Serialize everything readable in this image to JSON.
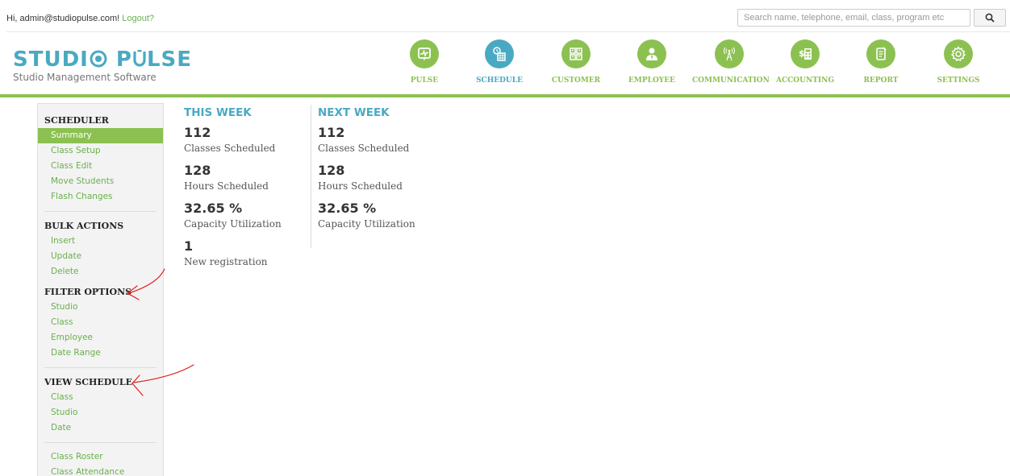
{
  "topbar": {
    "greeting": "Hi, admin@studiopulse.com!",
    "logout": "Logout?",
    "search_placeholder": "Search name, telephone, email, class, program etc"
  },
  "logo": {
    "title": "STUDIO PULSE",
    "title_part1": "STUDI",
    "title_part2": "P",
    "title_part3": "LSE",
    "subtitle": "Studio Management Software"
  },
  "nav": [
    {
      "label": "PULSE",
      "icon": "pulse-monitor-icon",
      "active": false
    },
    {
      "label": "SCHEDULE",
      "icon": "calendar-clock-icon",
      "active": true
    },
    {
      "label": "CUSTOMER",
      "icon": "customer-grid-icon",
      "active": false
    },
    {
      "label": "EMPLOYEE",
      "icon": "employee-icon",
      "active": false
    },
    {
      "label": "COMMUNICATION",
      "icon": "antenna-icon",
      "active": false
    },
    {
      "label": "ACCOUNTING",
      "icon": "calculator-icon",
      "active": false
    },
    {
      "label": "REPORT",
      "icon": "report-icon",
      "active": false
    },
    {
      "label": "SETTINGS",
      "icon": "gear-icon",
      "active": false
    }
  ],
  "sidebar": {
    "sections": [
      {
        "title": "SCHEDULER",
        "items": [
          "Summary",
          "Class Setup",
          "Class Edit",
          "Move Students",
          "Flash Changes"
        ],
        "active_index": 0
      },
      {
        "title": "BULK ACTIONS",
        "items": [
          "Insert",
          "Update",
          "Delete"
        ]
      },
      {
        "title": "FILTER OPTIONS",
        "items": [
          "Studio",
          "Class",
          "Employee",
          "Date Range"
        ]
      },
      {
        "title": "VIEW SCHEDULE",
        "items": [
          "Class",
          "Studio",
          "Date"
        ]
      },
      {
        "title": "",
        "items": [
          "Class Roster",
          "Class Attendance"
        ]
      }
    ]
  },
  "this_week": {
    "title": "THIS WEEK",
    "stats": [
      {
        "value": "112",
        "label": "Classes Scheduled"
      },
      {
        "value": "128",
        "label": "Hours Scheduled"
      },
      {
        "value": "32.65 %",
        "label": "Capacity Utilization"
      },
      {
        "value": "1",
        "label": "New registration"
      }
    ]
  },
  "next_week": {
    "title": "NEXT WEEK",
    "stats": [
      {
        "value": "112",
        "label": "Classes Scheduled"
      },
      {
        "value": "128",
        "label": "Hours Scheduled"
      },
      {
        "value": "32.65 %",
        "label": "Capacity Utilization"
      }
    ]
  },
  "colors": {
    "brand_green": "#8cc152",
    "brand_blue": "#4aa9c2",
    "link_green": "#6ab04c",
    "annotation_red": "#e02020"
  }
}
